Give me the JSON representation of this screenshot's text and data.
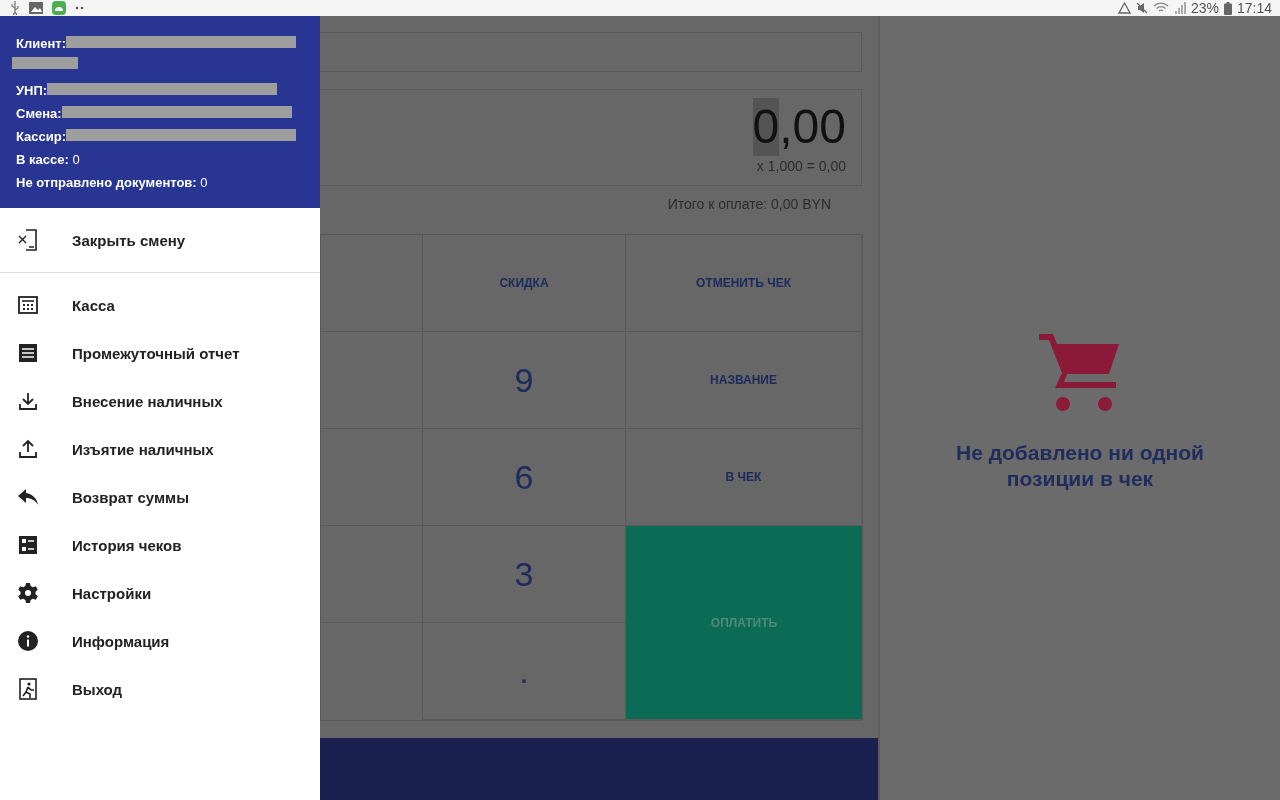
{
  "status_bar": {
    "battery": "23%",
    "time": "17:14"
  },
  "main": {
    "amount_digits": [
      {
        "text": "0",
        "selected": true
      },
      {
        "text": ",00",
        "selected": false
      }
    ],
    "multiplier": "x 1,000 = 0,00",
    "total": "Итого к оплате: 0,00 BYN",
    "keys": [
      {
        "label": "СКИДКА",
        "kind": "action"
      },
      {
        "label": "ОТМЕНИТЬ ЧЕК",
        "kind": "action"
      },
      {
        "label": "9",
        "kind": "digit"
      },
      {
        "label": "НАЗВАНИЕ",
        "kind": "action"
      },
      {
        "label": "6",
        "kind": "digit"
      },
      {
        "label": "В ЧЕК",
        "kind": "action"
      },
      {
        "label": "3",
        "kind": "digit"
      },
      {
        "label": "ОПЛАТИТЬ",
        "kind": "pay"
      },
      {
        "label": ".",
        "kind": "digit"
      }
    ]
  },
  "cart_panel": {
    "message": "Не добавлено ни одной позиции в чек"
  },
  "drawer": {
    "header": [
      {
        "label": "Клиент:",
        "kind": "wrapped"
      },
      {
        "label": "УНП:",
        "kind": "redacted"
      },
      {
        "label": "Смена:",
        "kind": "redacted"
      },
      {
        "label": "Кассир:",
        "kind": "redacted"
      },
      {
        "label": "В кассе:",
        "value": "0",
        "kind": "plain"
      },
      {
        "label": "Не отправлено документов:",
        "value": "0",
        "kind": "plain"
      }
    ],
    "sections": [
      [
        {
          "label": "Закрыть смену"
        }
      ],
      [
        {
          "label": "Касса"
        },
        {
          "label": "Промежуточный отчет"
        },
        {
          "label": "Внесение наличных"
        },
        {
          "label": "Изъятие наличных"
        },
        {
          "label": "Возврат суммы"
        },
        {
          "label": "История чеков"
        },
        {
          "label": "Настройки"
        },
        {
          "label": "Информация"
        },
        {
          "label": "Выход"
        }
      ]
    ]
  }
}
